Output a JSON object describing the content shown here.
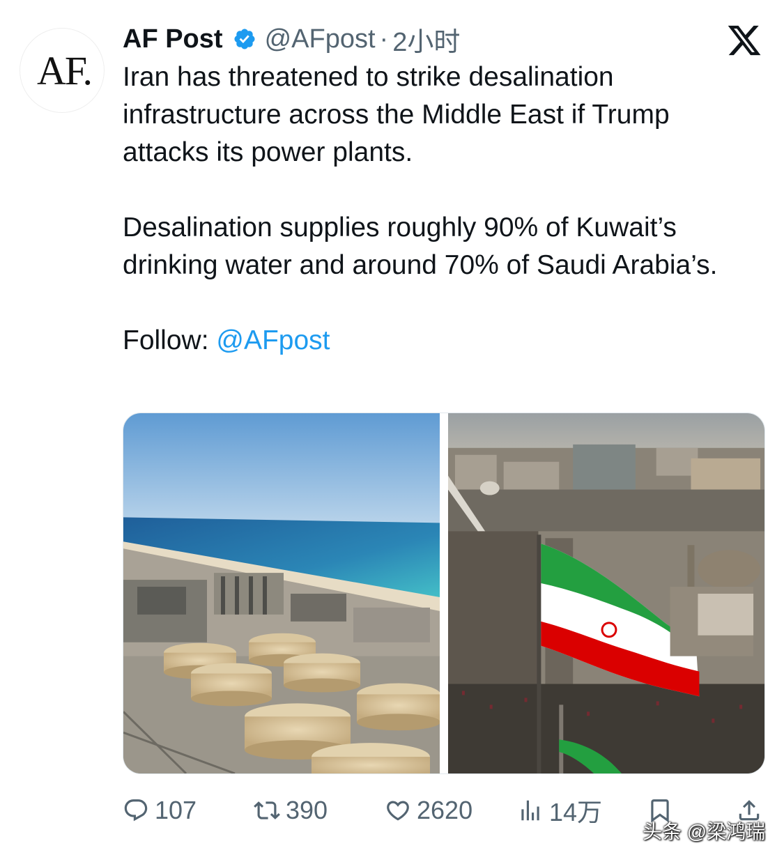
{
  "account": {
    "avatar_text": "AF.",
    "display_name": "AF Post",
    "handle": "@AFpost",
    "separator": "·",
    "time": "2小时"
  },
  "tweet": {
    "paragraph1": "Iran has threatened to strike desalination infrastructure across the Middle East if Trump attacks its power plants.",
    "paragraph2": "Desalination supplies roughly 90% of Kuwait’s drinking water and around 70% of Saudi Arabia’s.",
    "follow_label": "Follow: ",
    "follow_mention": "@AFpost"
  },
  "media": {
    "left_icon": "desalination-plant-photo",
    "right_icon": "iran-flag-over-city-photo"
  },
  "actions": {
    "replies": "107",
    "reposts": "390",
    "likes": "2620",
    "views": "14万"
  },
  "watermark": "头条 @梁鸿瑞",
  "colors": {
    "text": "#0f1419",
    "secondary": "#536471",
    "link": "#1d9bf0",
    "verified": "#1d9bf0"
  }
}
